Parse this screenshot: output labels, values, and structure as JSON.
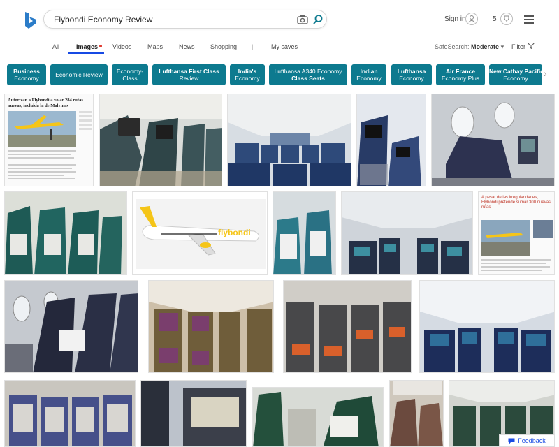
{
  "search": {
    "query": "Flybondi Economy Review"
  },
  "header": {
    "signin": "Sign in",
    "rewards_count": "5"
  },
  "tabs": [
    {
      "label": "All"
    },
    {
      "label": "Images"
    },
    {
      "label": "Videos"
    },
    {
      "label": "Maps"
    },
    {
      "label": "News"
    },
    {
      "label": "Shopping"
    },
    {
      "label": "|"
    },
    {
      "label": "My saves"
    }
  ],
  "safesearch": {
    "label": "SafeSearch:",
    "value": "Moderate"
  },
  "filter": {
    "label": "Filter"
  },
  "chips": [
    {
      "bold": "Business",
      "rest": "Economy"
    },
    {
      "bold": "",
      "rest": "Economic Review"
    },
    {
      "bold": "",
      "rest": "Economy-",
      "rest2": "Class"
    },
    {
      "bold": "Lufthansa First Class",
      "rest": "Review"
    },
    {
      "bold": "India's",
      "rest": "Economy"
    },
    {
      "bold": "",
      "rest": "Lufthansa A340 Economy",
      "rest2": "Class Seats"
    },
    {
      "bold": "Indian",
      "rest": "Economy"
    },
    {
      "bold": "Lufthansa",
      "rest": "Economy"
    },
    {
      "bold": "Air France",
      "rest": "Economy Plus"
    },
    {
      "bold": "New Cathay Pacific",
      "rest": "Economy"
    }
  ],
  "article1": {
    "headline": "Autorizan a Flybondi a volar 284 rutas nuevas, incluida la de Malvinas"
  },
  "article2": {
    "headline": "A pesar de las irregularidades, Flybondi pretende sumar 300 nuevas rutas"
  },
  "plane": {
    "livery": "flybondi"
  },
  "feedback": {
    "label": "Feedback"
  },
  "colors": {
    "chip": "#0d7a8f",
    "accent": "#174ae4",
    "flybondi_yellow": "#f5c518"
  }
}
